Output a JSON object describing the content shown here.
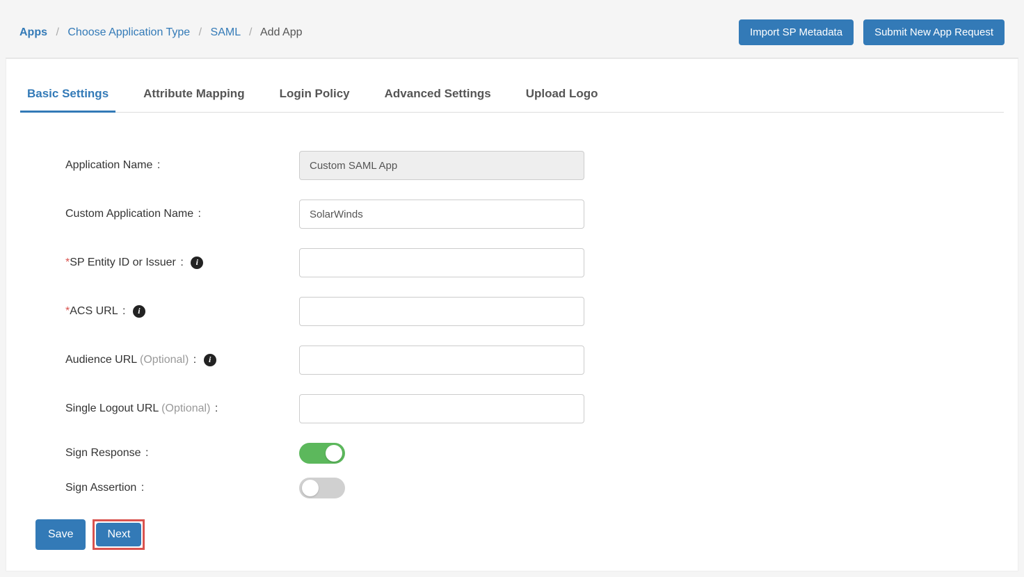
{
  "breadcrumb": {
    "apps": "Apps",
    "choose": "Choose Application Type",
    "saml": "SAML",
    "add": "Add App"
  },
  "header_buttons": {
    "import": "Import SP Metadata",
    "submit": "Submit New App Request"
  },
  "tabs": {
    "basic": "Basic Settings",
    "attribute": "Attribute Mapping",
    "login": "Login Policy",
    "advanced": "Advanced Settings",
    "upload": "Upload Logo"
  },
  "form": {
    "appname_label": "Application Name",
    "appname_value": "Custom SAML App",
    "customname_label": "Custom Application Name",
    "customname_value": "SolarWinds",
    "entityid_label": "SP Entity ID or Issuer",
    "entityid_value": "",
    "acsurl_label": "ACS URL",
    "acsurl_value": "",
    "audience_label": "Audience URL",
    "audience_value": "",
    "slo_label": "Single Logout URL",
    "slo_value": "",
    "signresponse_label": "Sign Response",
    "signassertion_label": "Sign Assertion",
    "optional_text": "(Optional)",
    "required_mark": "*",
    "colon": " :"
  },
  "footer": {
    "save": "Save",
    "next": "Next"
  },
  "toggles": {
    "sign_response": true,
    "sign_assertion": false
  }
}
